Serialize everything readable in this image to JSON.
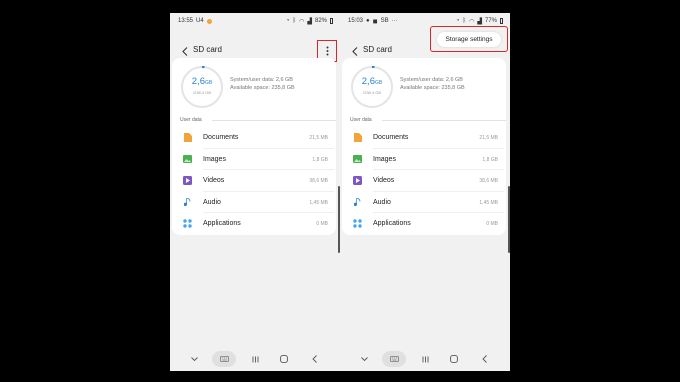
{
  "colors": {
    "accent": "#2a82d1",
    "highlight": "#d9262b",
    "documents": "#f2a33a",
    "images": "#4caf50",
    "videos": "#7e57c2",
    "audio": "#2a82d1",
    "applications": "#42a5f5"
  },
  "left": {
    "status": {
      "time": "13:55",
      "carrier": "U4",
      "battery": "82%"
    },
    "title": "SD card",
    "storage": {
      "used": "2,6",
      "used_unit": "GB",
      "total": "/238,4 GB",
      "system": "System/user data: 2,6 GB",
      "available": "Available space: 235,8 GB"
    },
    "section": "User data",
    "categories": [
      {
        "icon": "documents-icon",
        "label": "Documents",
        "size": "21,5 MB"
      },
      {
        "icon": "images-icon",
        "label": "Images",
        "size": "1,8 GB"
      },
      {
        "icon": "videos-icon",
        "label": "Videos",
        "size": "38,6 MB"
      },
      {
        "icon": "audio-icon",
        "label": "Audio",
        "size": "1,45 MB"
      },
      {
        "icon": "applications-icon",
        "label": "Applications",
        "size": "0 MB"
      }
    ]
  },
  "right": {
    "status": {
      "time": "15:03",
      "carrier": "SB",
      "battery": "77%"
    },
    "title": "SD card",
    "menu": {
      "item": "Storage settings"
    },
    "storage": {
      "used": "2,6",
      "used_unit": "GB",
      "total": "/238,4 GB",
      "system": "System/user data: 2,6 GB",
      "available": "Available space: 235,8 GB"
    },
    "section": "User data",
    "categories": [
      {
        "icon": "documents-icon",
        "label": "Documents",
        "size": "21,5 MB"
      },
      {
        "icon": "images-icon",
        "label": "Images",
        "size": "1,8 GB"
      },
      {
        "icon": "videos-icon",
        "label": "Videos",
        "size": "38,6 MB"
      },
      {
        "icon": "audio-icon",
        "label": "Audio",
        "size": "1,45 MB"
      },
      {
        "icon": "applications-icon",
        "label": "Applications",
        "size": "0 MB"
      }
    ]
  }
}
